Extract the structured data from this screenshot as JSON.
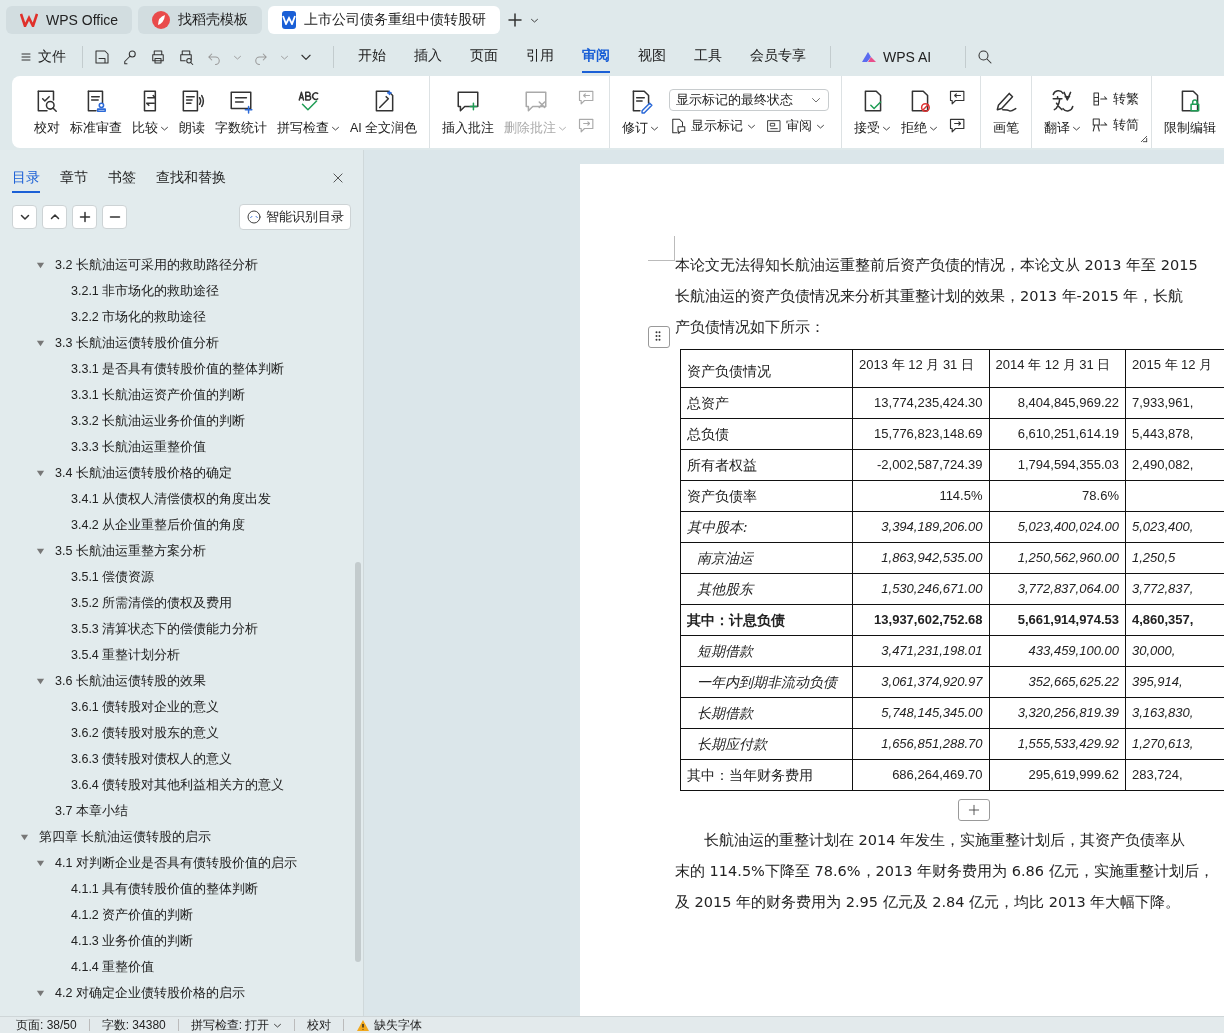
{
  "tabs": [
    {
      "title": "WPS Office",
      "selected": false
    },
    {
      "title": "找稻壳模板",
      "selected": false
    },
    {
      "title": "上市公司债务重组中债转股研",
      "selected": true
    }
  ],
  "menu": {
    "file": "文件",
    "tabs": [
      {
        "label": "开始",
        "selected": false
      },
      {
        "label": "插入",
        "selected": false
      },
      {
        "label": "页面",
        "selected": false
      },
      {
        "label": "引用",
        "selected": false
      },
      {
        "label": "审阅",
        "selected": true
      },
      {
        "label": "视图",
        "selected": false
      },
      {
        "label": "工具",
        "selected": false
      },
      {
        "label": "会员专享",
        "selected": false
      }
    ],
    "ai": "WPS AI"
  },
  "ribbon": {
    "groups": [
      {
        "items": [
          {
            "kind": "big",
            "label": "校对",
            "dropdown": false,
            "disabled": false
          },
          {
            "kind": "big",
            "label": "标准审查",
            "dropdown": false,
            "disabled": false
          },
          {
            "kind": "big",
            "label": "比较",
            "dropdown": true,
            "disabled": false
          },
          {
            "kind": "big",
            "label": "朗读",
            "dropdown": false,
            "disabled": false
          },
          {
            "kind": "big",
            "label": "字数统计",
            "dropdown": false,
            "disabled": false
          },
          {
            "kind": "big",
            "label": "拼写检查",
            "dropdown": true,
            "disabled": false
          },
          {
            "kind": "big",
            "label": "AI 全文润色",
            "dropdown": false,
            "disabled": false
          }
        ]
      },
      {
        "items": [
          {
            "kind": "big",
            "label": "插入批注",
            "dropdown": false,
            "disabled": false
          },
          {
            "kind": "big",
            "label": "删除批注",
            "dropdown": true,
            "disabled": true
          },
          {
            "kind": "icon_pair",
            "disabled": true
          }
        ]
      },
      {
        "items": [
          {
            "kind": "big",
            "label": "修订",
            "dropdown": true,
            "disabled": false
          },
          {
            "kind": "select_panel",
            "value": "显示标记的最终状态",
            "buttons": [
              {
                "label": "显示标记",
                "dropdown": true
              },
              {
                "label": "审阅",
                "dropdown": true
              }
            ]
          }
        ]
      },
      {
        "items": [
          {
            "kind": "big",
            "label": "接受",
            "dropdown": true,
            "disabled": false
          },
          {
            "kind": "big",
            "label": "拒绝",
            "dropdown": true,
            "disabled": false
          },
          {
            "kind": "icon_pair",
            "disabled": false
          }
        ]
      },
      {
        "items": [
          {
            "kind": "big",
            "label": "画笔",
            "dropdown": false,
            "disabled": false
          }
        ]
      },
      {
        "items": [
          {
            "kind": "big",
            "label": "翻译",
            "dropdown": true,
            "disabled": false
          },
          {
            "kind": "small_stack",
            "buttons": [
              {
                "label": "转繁"
              },
              {
                "label": "转简"
              }
            ]
          }
        ]
      },
      {
        "items": [
          {
            "kind": "big",
            "label": "限制编辑",
            "dropdown": false,
            "disabled": false
          }
        ]
      }
    ]
  },
  "nav_panel": {
    "tabs": [
      {
        "label": "目录",
        "selected": true
      },
      {
        "label": "章节",
        "selected": false
      },
      {
        "label": "书签",
        "selected": false
      },
      {
        "label": "查找和替换",
        "selected": false
      }
    ],
    "smart_button": "智能识别目录",
    "toc": [
      {
        "children": [
          {
            "label": "3.2 长航油运可采用的救助路径分析",
            "expanded": true,
            "children": [
              {
                "label": "3.2.1 非市场化的救助途径"
              },
              {
                "label": "3.2.2 市场化的救助途径"
              }
            ]
          },
          {
            "label": "3.3 长航油运债转股价值分析",
            "expanded": true,
            "children": [
              {
                "label": "3.3.1 是否具有债转股价值的整体判断"
              },
              {
                "label": "3.3.1 长航油运资产价值的判断"
              },
              {
                "label": "3.3.2 长航油运业务价值的判断"
              },
              {
                "label": "3.3.3 长航油运重整价值"
              }
            ]
          },
          {
            "label": "3.4 长航油运债转股价格的确定",
            "expanded": true,
            "children": [
              {
                "label": "3.4.1 从债权人清偿债权的角度出发"
              },
              {
                "label": "3.4.2 从企业重整后价值的角度"
              }
            ]
          },
          {
            "label": "3.5 长航油运重整方案分析",
            "expanded": true,
            "children": [
              {
                "label": "3.5.1 偿债资源"
              },
              {
                "label": "3.5.2 所需清偿的债权及费用"
              },
              {
                "label": "3.5.3 清算状态下的偿债能力分析"
              },
              {
                "label": "3.5.4 重整计划分析"
              }
            ]
          },
          {
            "label": "3.6 长航油运债转股的效果",
            "expanded": true,
            "children": [
              {
                "label": "3.6.1 债转股对企业的意义"
              },
              {
                "label": "3.6.2 债转股对股东的意义"
              },
              {
                "label": "3.6.3 债转股对债权人的意义"
              },
              {
                "label": "3.6.4 债转股对其他利益相关方的意义"
              }
            ]
          },
          {
            "label": "3.7 本章小结"
          }
        ]
      },
      {
        "label": "第四章 长航油运债转股的启示",
        "expanded": true,
        "children": [
          {
            "label": "4.1 对判断企业是否具有债转股价值的启示",
            "expanded": true,
            "children": [
              {
                "label": "4.1.1 具有债转股价值的整体判断"
              },
              {
                "label": "4.1.2 资产价值的判断"
              },
              {
                "label": "4.1.3 业务价值的判断"
              },
              {
                "label": "4.1.4 重整价值"
              }
            ]
          },
          {
            "label": "4.2 对确定企业债转股价格的启示",
            "expanded": true
          }
        ]
      }
    ]
  },
  "document": {
    "intro_lines": [
      "本论文无法得知长航油运重整前后资产负债的情况，本论文从 2013 年至 2015",
      "长航油运的资产负债情况来分析其重整计划的效果，2013 年-2015 年，长航",
      "产负债情况如下所示："
    ],
    "table": {
      "columns": [
        "资产负债情况",
        "2013 年 12 月 31 日",
        "2014 年 12 月 31 日",
        "2015 年 12 月"
      ],
      "rows": [
        {
          "kind": "plain",
          "cells": [
            "总资产",
            "13,774,235,424.30",
            "8,404,845,969.22",
            "7,933,961,"
          ]
        },
        {
          "kind": "plain",
          "cells": [
            "总负债",
            "15,776,823,148.69",
            "6,610,251,614.19",
            "5,443,878,"
          ]
        },
        {
          "kind": "plain",
          "cells": [
            "所有者权益",
            "-2,002,587,724.39",
            "1,794,594,355.03",
            "2,490,082,"
          ]
        },
        {
          "kind": "plain",
          "cells": [
            "资产负债率",
            "114.5%",
            "78.6%"
          ]
        },
        {
          "kind": "italic_head",
          "cells": [
            "其中股本:",
            "3,394,189,206.00",
            "5,023,400,024.00",
            "5,023,400,"
          ]
        },
        {
          "kind": "item",
          "cells": [
            "南京油运",
            "1,863,942,535.00",
            "1,250,562,960.00",
            "1,250,5"
          ]
        },
        {
          "kind": "item",
          "cells": [
            "其他股东",
            "1,530,246,671.00",
            "3,772,837,064.00",
            "3,772,837,"
          ]
        },
        {
          "kind": "bold_head",
          "cells": [
            "其中：计息负债",
            "13,937,602,752.68",
            "5,661,914,974.53",
            "4,860,357,"
          ]
        },
        {
          "kind": "item",
          "cells": [
            "短期借款",
            "3,471,231,198.01",
            "433,459,100.00",
            "30,000,"
          ]
        },
        {
          "kind": "item",
          "cells": [
            "一年内到期非流动负债",
            "3,061,374,920.97",
            "352,665,625.22",
            "395,914,"
          ]
        },
        {
          "kind": "item",
          "cells": [
            "长期借款",
            "5,748,145,345.00",
            "3,320,256,819.39",
            "3,163,830,"
          ]
        },
        {
          "kind": "item",
          "cells": [
            "长期应付款",
            "1,656,851,288.70",
            "1,555,533,429.92",
            "1,270,613,"
          ]
        },
        {
          "kind": "plain",
          "cells": [
            "其中：当年财务费用",
            "686,264,469.70",
            "295,619,999.62",
            "283,724,"
          ]
        }
      ]
    },
    "closing_lines": [
      "长航油运的重整计划在 2014 年发生，实施重整计划后，其资产负债率从",
      "末的 114.5%下降至 78.6%，2013 年财务费用为 6.86 亿元，实施重整计划后，",
      "及 2015 年的财务费用为 2.95 亿元及 2.84 亿元，均比 2013 年大幅下降。"
    ]
  },
  "status_bar": {
    "page": "页面: 38/50",
    "words": "字数: 34380",
    "spell": "拼写检查: 打开",
    "proof": "校对",
    "missing_fonts": "缺失字体"
  }
}
